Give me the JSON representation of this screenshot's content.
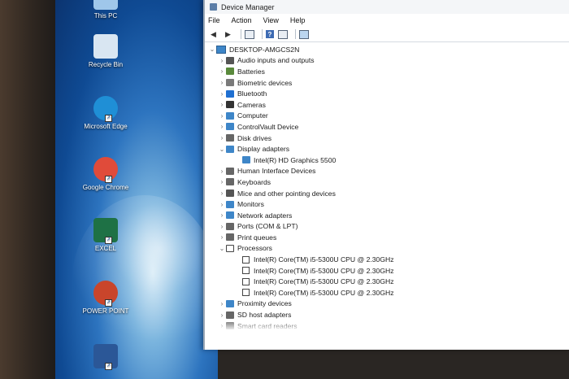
{
  "desktop": {
    "icons": [
      {
        "label": "This PC",
        "icon": "this-pc-icon",
        "color": "#9fc7ea"
      },
      {
        "label": "Recycle Bin",
        "icon": "recycle-bin-icon",
        "color": "#d9e6f2"
      },
      {
        "label": "Microsoft Edge",
        "icon": "edge-icon",
        "color": "#1f8fd6"
      },
      {
        "label": "Google Chrome",
        "icon": "chrome-icon",
        "color": "#e04b3a"
      },
      {
        "label": "EXCEL",
        "icon": "excel-icon",
        "color": "#1e7145"
      },
      {
        "label": "POWER POINT",
        "icon": "powerpoint-icon",
        "color": "#c9452b"
      },
      {
        "label": "",
        "icon": "word-icon",
        "color": "#2b5797"
      }
    ]
  },
  "window": {
    "title": "Device Manager",
    "menu": [
      "File",
      "Action",
      "View",
      "Help"
    ],
    "toolbar": [
      "back-arrow-icon",
      "forward-arrow-icon",
      "properties-icon",
      "help-icon",
      "view-icon",
      "monitor-icon"
    ]
  },
  "tree": {
    "root": "DESKTOP-AMGCS2N",
    "items": [
      {
        "label": "Audio inputs and outputs",
        "icon": "speaker-icon",
        "color": "#555555",
        "expanded": false
      },
      {
        "label": "Batteries",
        "icon": "battery-icon",
        "color": "#5a8a3c",
        "expanded": false
      },
      {
        "label": "Biometric devices",
        "icon": "biometric-icon",
        "color": "#7a7a7a",
        "expanded": false
      },
      {
        "label": "Bluetooth",
        "icon": "bluetooth-icon",
        "color": "#1f6fd1",
        "expanded": false
      },
      {
        "label": "Cameras",
        "icon": "camera-icon",
        "color": "#333333",
        "expanded": false
      },
      {
        "label": "Computer",
        "icon": "computer-icon",
        "color": "#3e86c8",
        "expanded": false
      },
      {
        "label": "ControlVault Device",
        "icon": "controlvault-icon",
        "color": "#3e86c8",
        "expanded": false
      },
      {
        "label": "Disk drives",
        "icon": "disk-icon",
        "color": "#666666",
        "expanded": false
      },
      {
        "label": "Display adapters",
        "icon": "display-adapter-icon",
        "color": "#3e86c8",
        "expanded": true,
        "children": [
          "Intel(R) HD Graphics 5500"
        ]
      },
      {
        "label": "Human Interface Devices",
        "icon": "hid-icon",
        "color": "#666666",
        "expanded": false
      },
      {
        "label": "Keyboards",
        "icon": "keyboard-icon",
        "color": "#666666",
        "expanded": false
      },
      {
        "label": "Mice and other pointing devices",
        "icon": "mouse-icon",
        "color": "#555555",
        "expanded": false
      },
      {
        "label": "Monitors",
        "icon": "monitor-icon",
        "color": "#3e86c8",
        "expanded": false
      },
      {
        "label": "Network adapters",
        "icon": "network-icon",
        "color": "#3e86c8",
        "expanded": false
      },
      {
        "label": "Ports (COM & LPT)",
        "icon": "port-icon",
        "color": "#666666",
        "expanded": false
      },
      {
        "label": "Print queues",
        "icon": "printer-icon",
        "color": "#666666",
        "expanded": false
      },
      {
        "label": "Processors",
        "icon": "processor-icon",
        "color": "#444444",
        "expanded": true,
        "children": [
          "Intel(R) Core(TM) i5-5300U CPU @ 2.30GHz",
          "Intel(R) Core(TM) i5-5300U CPU @ 2.30GHz",
          "Intel(R) Core(TM) i5-5300U CPU @ 2.30GHz",
          "Intel(R) Core(TM) i5-5300U CPU @ 2.30GHz"
        ]
      },
      {
        "label": "Proximity devices",
        "icon": "proximity-icon",
        "color": "#3e86c8",
        "expanded": false
      },
      {
        "label": "SD host adapters",
        "icon": "sd-card-icon",
        "color": "#666666",
        "expanded": false
      },
      {
        "label": "Smart card readers",
        "icon": "smart-card-icon",
        "color": "#666666",
        "expanded": false
      }
    ]
  }
}
